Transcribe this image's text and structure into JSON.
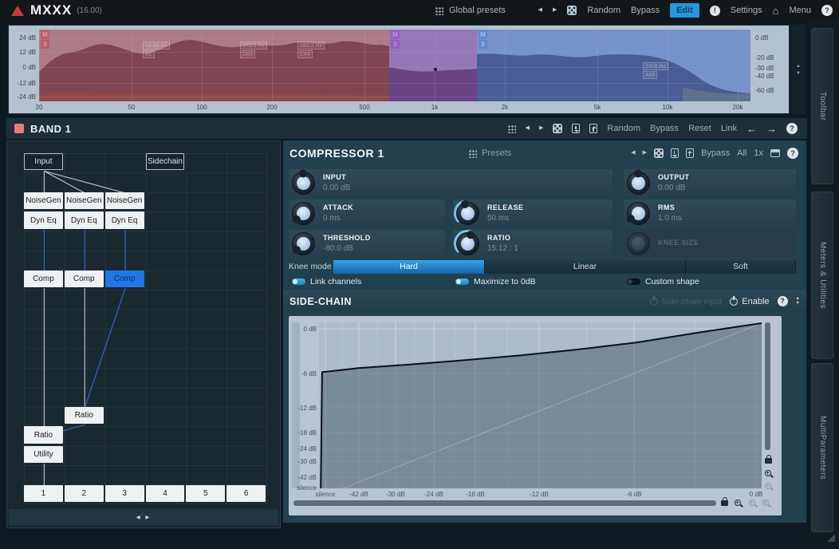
{
  "titlebar": {
    "app_name": "MXXX",
    "version": "(16.00)",
    "global_presets": "Global presets",
    "random": "Random",
    "bypass": "Bypass",
    "edit": "Edit",
    "settings": "Settings",
    "menu": "Menu",
    "help": "?"
  },
  "band_overview": {
    "left_scale": [
      "24 dB",
      "12 dB",
      "0 dB",
      "-12 dB",
      "-24 dB"
    ],
    "right_scale": [
      "0 dB",
      "-20 dB",
      "-30 dB",
      "-40 dB",
      "-60 dB"
    ],
    "freq_scale": [
      "20",
      "50",
      "100",
      "200",
      "500",
      "1k",
      "2k",
      "5k",
      "10k",
      "20k"
    ],
    "bands": [
      {
        "name": "band-1",
        "overlay": "rgba(165,52,66,0.50)",
        "chip_bg": "rgba(195,70,82,0.55)",
        "chip_text": "#dd9aa0",
        "ms": [
          "M",
          "S"
        ]
      },
      {
        "name": "band-2",
        "overlay": "rgba(120,50,160,0.52)",
        "chip_bg": "rgba(150,70,200,0.50)",
        "chip_text": "#bb94d6",
        "ms": [
          "M",
          "S"
        ]
      },
      {
        "name": "band-3",
        "overlay": "rgba(52,100,196,0.50)",
        "chip_bg": "rgba(82,126,214,0.55)",
        "chip_text": "#a3bce2",
        "ms": [
          "M",
          "S"
        ]
      }
    ],
    "point_labels": [
      {
        "freq": "54.58 Hz",
        "note": "A1"
      },
      {
        "freq": "153.5 Hz",
        "note": "D#3"
      },
      {
        "freq": "283.2 Hz",
        "note": "C#4"
      },
      {
        "freq": "7458 Hz",
        "note": "A#8"
      }
    ]
  },
  "band_toolbar": {
    "title": "BAND 1",
    "random": "Random",
    "bypass": "Bypass",
    "reset": "Reset",
    "link": "Link",
    "help": "?"
  },
  "routing": {
    "nodes": [
      {
        "id": "input",
        "label": "Input",
        "col": 0,
        "row": 0,
        "variant": "outline"
      },
      {
        "id": "sidechain",
        "label": "Sidechain",
        "col": 3,
        "row": 0,
        "variant": "outline"
      },
      {
        "id": "ng1",
        "label": "NoiseGen",
        "col": 0,
        "row": 2,
        "variant": "solid"
      },
      {
        "id": "ng2",
        "label": "NoiseGen",
        "col": 1,
        "row": 2,
        "variant": "solid"
      },
      {
        "id": "ng3",
        "label": "NoiseGen",
        "col": 2,
        "row": 2,
        "variant": "solid"
      },
      {
        "id": "dq1",
        "label": "Dyn Eq",
        "col": 0,
        "row": 3,
        "variant": "solid"
      },
      {
        "id": "dq2",
        "label": "Dyn Eq",
        "col": 1,
        "row": 3,
        "variant": "solid"
      },
      {
        "id": "dq3",
        "label": "Dyn Eq",
        "col": 2,
        "row": 3,
        "variant": "solid"
      },
      {
        "id": "cp1",
        "label": "Comp",
        "col": 0,
        "row": 6,
        "variant": "solid"
      },
      {
        "id": "cp2",
        "label": "Comp",
        "col": 1,
        "row": 6,
        "variant": "solid"
      },
      {
        "id": "cp3",
        "label": "Comp",
        "col": 2,
        "row": 6,
        "variant": "active"
      },
      {
        "id": "rt2",
        "label": "Ratio",
        "col": 1,
        "row": 13,
        "variant": "solid"
      },
      {
        "id": "rt1",
        "label": "Ratio",
        "col": 0,
        "row": 14,
        "variant": "solid"
      },
      {
        "id": "ut",
        "label": "Utility",
        "col": 0,
        "row": 15,
        "variant": "solid"
      },
      {
        "id": "o1",
        "label": "1",
        "col": 0,
        "row": 17,
        "variant": "solid"
      },
      {
        "id": "o2",
        "label": "2",
        "col": 1,
        "row": 17,
        "variant": "solid"
      },
      {
        "id": "o3",
        "label": "3",
        "col": 2,
        "row": 17,
        "variant": "solid"
      },
      {
        "id": "o4",
        "label": "4",
        "col": 3,
        "row": 17,
        "variant": "solid"
      },
      {
        "id": "o5",
        "label": "5",
        "col": 4,
        "row": 17,
        "variant": "solid"
      },
      {
        "id": "o6",
        "label": "6",
        "col": 5,
        "row": 17,
        "variant": "solid"
      }
    ],
    "wires": [
      {
        "from": "input",
        "to": "ng1",
        "color": "gray"
      },
      {
        "from": "input",
        "to": "ng2",
        "color": "gray"
      },
      {
        "from": "input",
        "to": "ng3",
        "color": "gray"
      },
      {
        "from": "dq1",
        "to": "cp1",
        "color": "blue"
      },
      {
        "from": "dq2",
        "to": "cp2",
        "color": "blue"
      },
      {
        "from": "dq3",
        "to": "cp3",
        "color": "blue"
      },
      {
        "from": "cp1",
        "to": "rt1",
        "color": "gray"
      },
      {
        "from": "cp2",
        "to": "rt2",
        "color": "gray"
      },
      {
        "from": "cp3",
        "to": "rt2",
        "color": "blue"
      },
      {
        "from": "rt2",
        "to": "rt1",
        "color": "blue"
      },
      {
        "from": "ut",
        "to": "o1",
        "color": "gray"
      }
    ]
  },
  "compressor": {
    "title": "COMPRESSOR 1",
    "presets": "Presets",
    "bypass": "Bypass",
    "all": "All",
    "oversampling": "1x",
    "help": "?",
    "knobs": [
      {
        "label": "INPUT",
        "value": "0.00 dB",
        "angle": 0,
        "arc": 0,
        "row": 0,
        "col": 0,
        "wide": true
      },
      {
        "label": "OUTPUT",
        "value": "0.00 dB",
        "angle": 0,
        "arc": 0,
        "row": 0,
        "col": 2
      },
      {
        "label": "ATTACK",
        "value": "0 ms",
        "angle": -135,
        "arc": 0,
        "row": 1,
        "col": 0
      },
      {
        "label": "RELEASE",
        "value": "50 ms",
        "angle": -15,
        "arc": 120,
        "row": 1,
        "col": 1
      },
      {
        "label": "RMS",
        "value": "1.0 ms",
        "angle": -128,
        "arc": 0,
        "row": 1,
        "col": 2
      },
      {
        "label": "THRESHOLD",
        "value": "-80.0 dB",
        "angle": -135,
        "arc": 0,
        "row": 2,
        "col": 0
      },
      {
        "label": "RATIO",
        "value": "15.12 : 1",
        "angle": 20,
        "arc": 155,
        "row": 2,
        "col": 1
      },
      {
        "label": "KNEE SIZE",
        "value": "",
        "angle": -135,
        "arc": 0,
        "row": 2,
        "col": 2,
        "disabled": true
      }
    ],
    "knee_mode": {
      "label": "Knee mode",
      "options": [
        "Hard",
        "Linear",
        "Soft"
      ],
      "selected": "Hard"
    },
    "toggles": [
      {
        "label": "Link channels",
        "on": true
      },
      {
        "label": "Maximize to 0dB",
        "on": true
      },
      {
        "label": "Custom shape",
        "on": false
      }
    ]
  },
  "sidechain": {
    "title": "SIDE-CHAIN",
    "input_label": "Side-chain input",
    "enable": "Enable",
    "help": "?",
    "graph": {
      "y_labels": [
        "0 dB",
        "-6 dB",
        "-12 dB",
        "-18 dB",
        "-24 dB",
        "-30 dB",
        "-42 dB",
        "silence"
      ],
      "x_labels": [
        "silence",
        "-42 dB",
        "-30 dB",
        "-24 dB",
        "-18 dB",
        "-12 dB",
        "-6 dB",
        "0 dB"
      ],
      "curve_points": [
        [
          0.004,
          1.0
        ],
        [
          0.007,
          0.3
        ],
        [
          0.09,
          0.275
        ],
        [
          0.2,
          0.255
        ],
        [
          0.32,
          0.23
        ],
        [
          0.45,
          0.2
        ],
        [
          0.58,
          0.165
        ],
        [
          0.72,
          0.12
        ],
        [
          0.86,
          0.06
        ],
        [
          1.0,
          0.005
        ]
      ]
    }
  },
  "sidebar_tabs": [
    {
      "label": "Toolbar"
    },
    {
      "label": "Meters & Utilities"
    },
    {
      "label": "MultiParameters"
    }
  ],
  "colors": {
    "accent": "#2a96dd",
    "band_swatch": "#e87d7d",
    "active_node": "#1f76e8"
  }
}
